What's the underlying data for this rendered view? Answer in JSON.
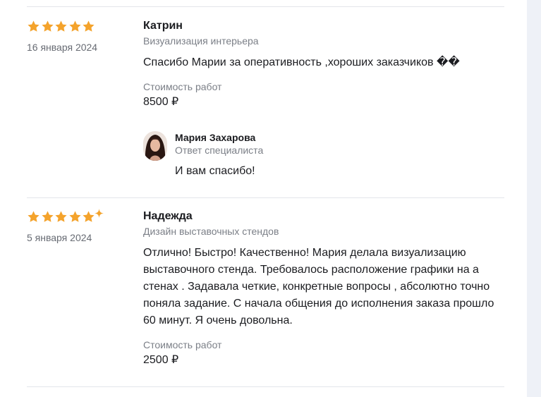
{
  "colors": {
    "star": "#f4a32c",
    "divider": "#e3e5ea",
    "muted": "#7b7f87"
  },
  "icons": {
    "star": "star-icon",
    "sparkle": "sparkle-icon"
  },
  "reviews": [
    {
      "rating": 5,
      "date": "16 января 2024",
      "name": "Катрин",
      "category": "Визуализация интерьера",
      "text": "Спасибо Марии за оперативность ,хороших заказчиков ",
      "emoji": "��",
      "cost_label": "Стоимость работ",
      "cost": "8500 ₽",
      "reply": {
        "name": "Мария Захарова",
        "role": "Ответ специалиста",
        "text": "И вам спасибо!"
      }
    },
    {
      "rating": 5,
      "date": "5 января 2024",
      "name": "Надежда",
      "category": "Дизайн выставочных стендов",
      "text": "Отлично! Быстро! Качественно! Мария делала визуализацию выставочного стенда. Требовалось расположение графики на а стенах . Задавала четкие, конкретные вопросы , абсолютно точно поняла задание. С начала общения до исполнения заказа прошло 60 минут. Я очень довольна.",
      "cost_label": "Стоимость работ",
      "cost": "2500 ₽"
    }
  ]
}
